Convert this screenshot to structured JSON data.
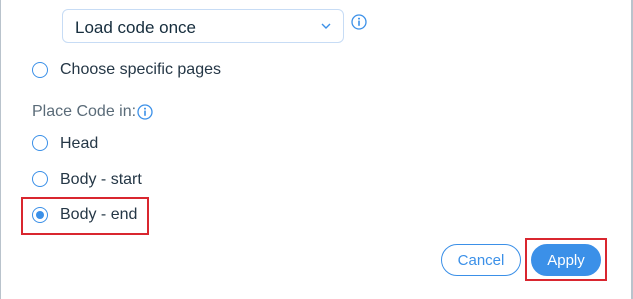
{
  "load_select": {
    "value": "Load code once"
  },
  "options": {
    "specific_pages_label": "Choose specific pages"
  },
  "place_code": {
    "label": "Place Code in:",
    "items": [
      {
        "label": "Head",
        "checked": false
      },
      {
        "label": "Body - start",
        "checked": false
      },
      {
        "label": "Body - end",
        "checked": true
      }
    ]
  },
  "footer": {
    "cancel_label": "Cancel",
    "apply_label": "Apply"
  },
  "colors": {
    "accent": "#3b90e8",
    "highlight": "#d9262f"
  },
  "icons": [
    "chevron-down-icon",
    "info-icon"
  ]
}
